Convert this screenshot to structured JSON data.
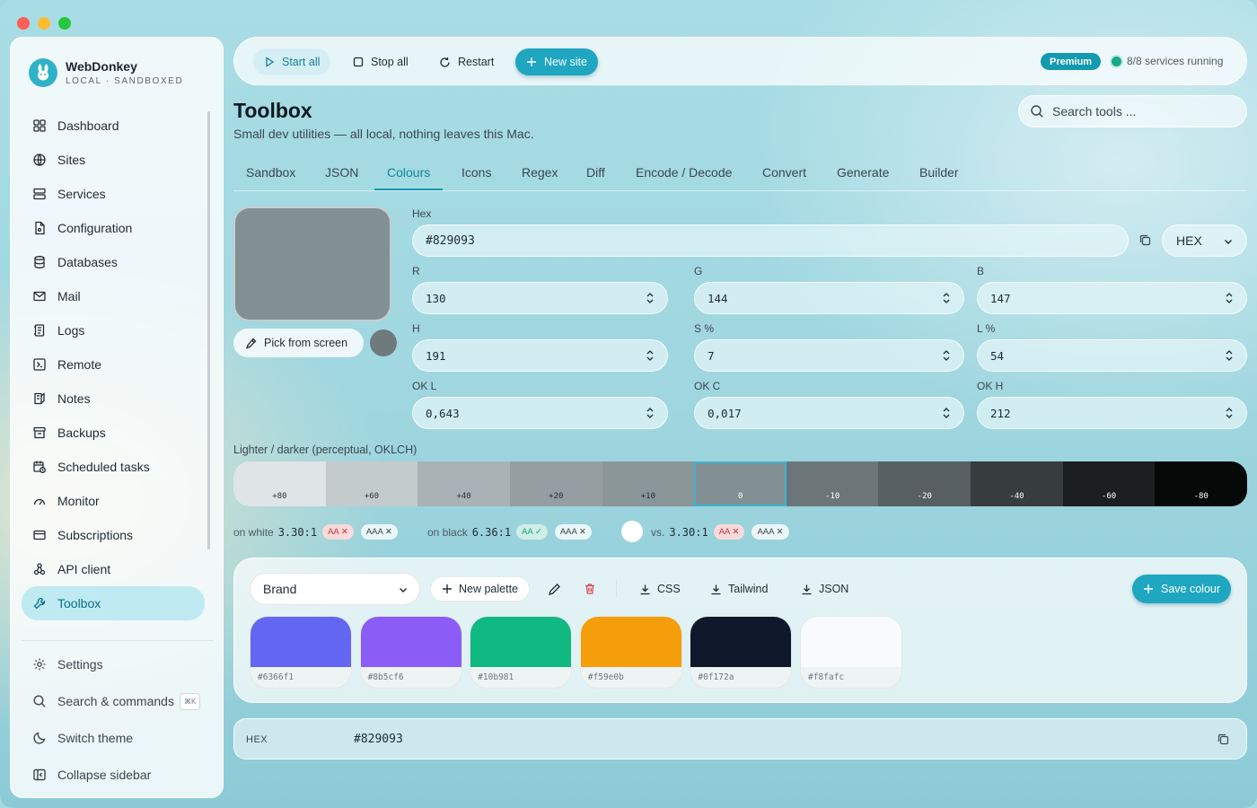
{
  "window": {
    "traffic_colors": [
      "#fe5f57",
      "#febc2e",
      "#28c840"
    ]
  },
  "sidebar": {
    "app_name": "WebDonkey",
    "app_sub": "LOCAL · SANDBOXED",
    "items": [
      {
        "label": "Dashboard",
        "icon": "dashboard-icon"
      },
      {
        "label": "Sites",
        "icon": "globe-icon"
      },
      {
        "label": "Services",
        "icon": "server-icon"
      },
      {
        "label": "Configuration",
        "icon": "config-file-icon"
      },
      {
        "label": "Databases",
        "icon": "database-icon"
      },
      {
        "label": "Mail",
        "icon": "mail-icon"
      },
      {
        "label": "Logs",
        "icon": "logs-icon"
      },
      {
        "label": "Remote",
        "icon": "remote-icon"
      },
      {
        "label": "Notes",
        "icon": "notes-icon"
      },
      {
        "label": "Backups",
        "icon": "archive-icon"
      },
      {
        "label": "Scheduled tasks",
        "icon": "calendar-clock-icon"
      },
      {
        "label": "Monitor",
        "icon": "gauge-icon"
      },
      {
        "label": "Subscriptions",
        "icon": "credit-card-icon"
      },
      {
        "label": "API client",
        "icon": "api-icon"
      },
      {
        "label": "Toolbox",
        "icon": "wrench-icon",
        "active": true
      }
    ],
    "bottom": {
      "settings": "Settings",
      "search": "Search & commands",
      "search_kbd": "⌘K",
      "theme": "Switch theme",
      "collapse": "Collapse sidebar"
    }
  },
  "toolbar": {
    "start_all": "Start all",
    "stop_all": "Stop all",
    "restart": "Restart",
    "new_site": "New site",
    "premium": "Premium",
    "status": "8/8 services running"
  },
  "page": {
    "title": "Toolbox",
    "subtitle": "Small dev utilities — all local, nothing leaves this Mac.",
    "search_placeholder": "Search tools ..."
  },
  "tabs": [
    "Sandbox",
    "JSON",
    "Colours",
    "Icons",
    "Regex",
    "Diff",
    "Encode / Decode",
    "Convert",
    "Generate",
    "Builder"
  ],
  "active_tab": "Colours",
  "colour": {
    "current": "#829093",
    "pick_label": "Pick from screen",
    "hex_label": "Hex",
    "hex_value": "#829093",
    "format": "HEX",
    "fields": {
      "r": {
        "label": "R",
        "value": "130"
      },
      "g": {
        "label": "G",
        "value": "144"
      },
      "b": {
        "label": "B",
        "value": "147"
      },
      "h": {
        "label": "H",
        "value": "191"
      },
      "s": {
        "label": "S %",
        "value": "7"
      },
      "l": {
        "label": "L %",
        "value": "54"
      },
      "okl": {
        "label": "OK L",
        "value": "0,643"
      },
      "okc": {
        "label": "OK C",
        "value": "0,017"
      },
      "okh": {
        "label": "OK H",
        "value": "212"
      }
    }
  },
  "ramp": {
    "label": "Lighter / darker (perceptual, OKLCH)",
    "steps": [
      {
        "label": "+80",
        "color": "#dfe4e6",
        "text": "#2a343b"
      },
      {
        "label": "+60",
        "color": "#c4cbcd",
        "text": "#2a343b"
      },
      {
        "label": "+40",
        "color": "#a9b2b5",
        "text": "#2a343b"
      },
      {
        "label": "+20",
        "color": "#959fa2",
        "text": "#1f2b34"
      },
      {
        "label": "+10",
        "color": "#8b9699",
        "text": "#1f2b34"
      },
      {
        "label": "0",
        "color": "#829093",
        "text": "#ffffff",
        "selected": true
      },
      {
        "label": "-10",
        "color": "#6c7679",
        "text": "#ffffff"
      },
      {
        "label": "-20",
        "color": "#575f62",
        "text": "#ffffff"
      },
      {
        "label": "-40",
        "color": "#373c3e",
        "text": "#ffffff"
      },
      {
        "label": "-60",
        "color": "#1c1f20",
        "text": "#ffffff"
      },
      {
        "label": "-80",
        "color": "#070808",
        "text": "#ffffff"
      }
    ]
  },
  "contrast": {
    "on_white": {
      "label": "on white",
      "ratio": "3.30:1",
      "aa": "AA ✕",
      "aaa": "AAA ✕"
    },
    "on_black": {
      "label": "on black",
      "ratio": "6.36:1",
      "aa": "AA ✓",
      "aaa": "AAA ✕"
    },
    "vs": {
      "label": "vs.",
      "ratio": "3.30:1",
      "aa": "AA ✕",
      "aaa": "AAA ✕"
    }
  },
  "palette": {
    "name": "Brand",
    "new_palette": "New palette",
    "export_css": "CSS",
    "export_tailwind": "Tailwind",
    "export_json": "JSON",
    "save": "Save colour",
    "chips": [
      {
        "hex": "#6366f1",
        "color": "#6366f1"
      },
      {
        "hex": "#8b5cf6",
        "color": "#8b5cf6"
      },
      {
        "hex": "#10b981",
        "color": "#10b981"
      },
      {
        "hex": "#f59e0b",
        "color": "#f59e0b"
      },
      {
        "hex": "#0f172a",
        "color": "#0f172a"
      },
      {
        "hex": "#f8fafc",
        "color": "#f8fafc"
      }
    ]
  },
  "output": {
    "label": "HEX",
    "value": "#829093"
  }
}
